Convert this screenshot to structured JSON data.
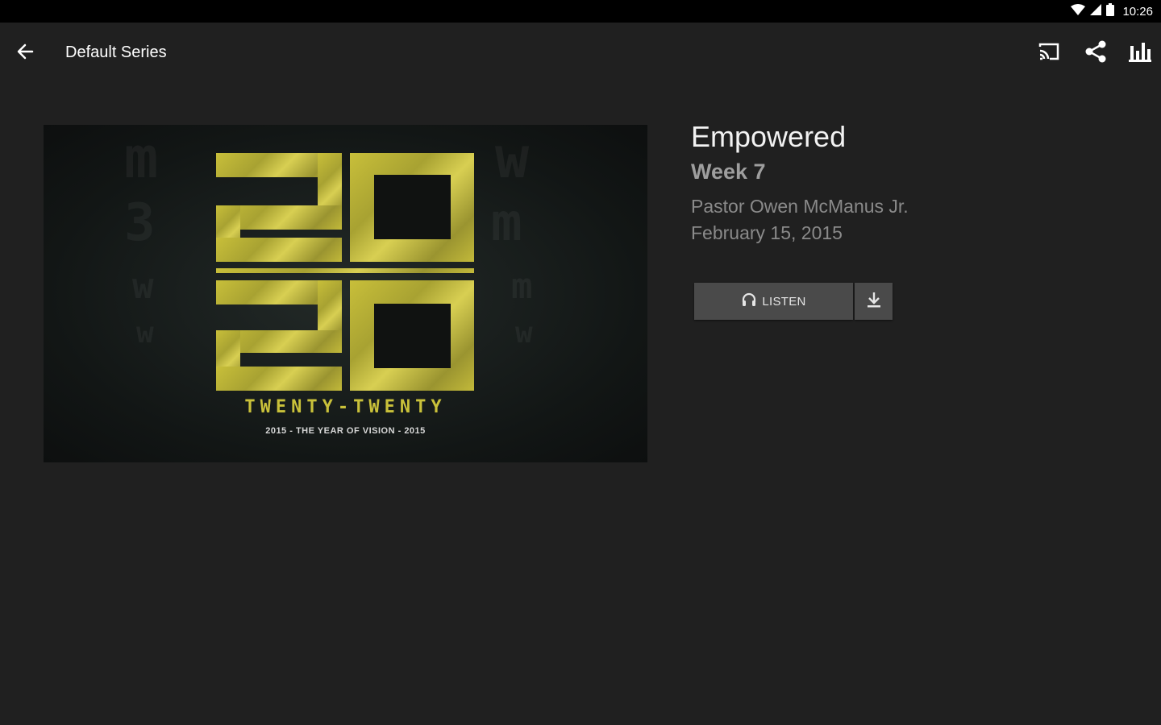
{
  "status_bar": {
    "time": "10:26",
    "icons": [
      "wifi-icon",
      "signal-icon",
      "battery-icon"
    ]
  },
  "toolbar": {
    "title": "Default Series",
    "icons": [
      "back-arrow-icon",
      "cast-icon",
      "share-icon",
      "bar-chart-icon"
    ]
  },
  "artwork": {
    "big_text_top": "20",
    "big_text_bottom": "20",
    "wordmark": "TWENTY-TWENTY",
    "tagline": "2015 - THE YEAR OF VISION - 2015"
  },
  "sermon": {
    "title": "Empowered",
    "subtitle": "Week 7",
    "speaker": "Pastor Owen McManus Jr.",
    "date": "February 15, 2015"
  },
  "actions": {
    "listen_label": "LISTEN",
    "listen_icon": "headphones-icon",
    "download_icon": "download-icon"
  },
  "colors": {
    "background": "#202020",
    "status_bar": "#000000",
    "button": "#4a4a4a",
    "artwork_gold": "#c8bf3a"
  }
}
